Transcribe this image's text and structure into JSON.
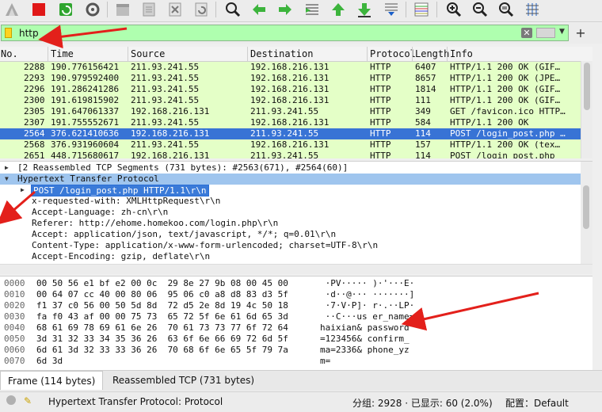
{
  "toolbar": {
    "icons": [
      "shark-fin-icon",
      "stop-capture-icon",
      "restart-capture-icon",
      "capture-options-icon",
      "open-file-icon",
      "save-file-icon",
      "close-file-icon",
      "reload-file-icon",
      "find-packet-icon",
      "go-back-icon",
      "go-forward-icon",
      "go-to-packet-icon",
      "go-first-icon",
      "go-last-icon",
      "auto-scroll-icon",
      "colorize-icon",
      "zoom-in-icon",
      "zoom-out-icon",
      "zoom-normal-icon",
      "resize-columns-icon"
    ]
  },
  "filter": {
    "value": "http",
    "clear_icon": "clear-icon",
    "apply_icon": "apply-arrow-icon",
    "dropdown_icon": "chevron-down-icon",
    "add_label": "+"
  },
  "packet_list": {
    "columns": [
      "No.",
      "Time",
      "Source",
      "Destination",
      "Protocol",
      "Length",
      "Info"
    ],
    "rows": [
      {
        "no": "2288",
        "time": "190.776156421",
        "src": "211.93.241.55",
        "dst": "192.168.216.131",
        "proto": "HTTP",
        "len": "6407",
        "info": "HTTP/1.1 200 OK  (GIF…"
      },
      {
        "no": "2293",
        "time": "190.979592400",
        "src": "211.93.241.55",
        "dst": "192.168.216.131",
        "proto": "HTTP",
        "len": "8657",
        "info": "HTTP/1.1 200 OK  (JPE…"
      },
      {
        "no": "2296",
        "time": "191.286241286",
        "src": "211.93.241.55",
        "dst": "192.168.216.131",
        "proto": "HTTP",
        "len": "1814",
        "info": "HTTP/1.1 200 OK  (GIF…"
      },
      {
        "no": "2300",
        "time": "191.619815902",
        "src": "211.93.241.55",
        "dst": "192.168.216.131",
        "proto": "HTTP",
        "len": "111",
        "info": "HTTP/1.1 200 OK  (GIF…"
      },
      {
        "no": "2305",
        "time": "191.647061337",
        "src": "192.168.216.131",
        "dst": "211.93.241.55",
        "proto": "HTTP",
        "len": "349",
        "info": "GET /favicon.ico HTTP…"
      },
      {
        "no": "2307",
        "time": "191.755552671",
        "src": "211.93.241.55",
        "dst": "192.168.216.131",
        "proto": "HTTP",
        "len": "584",
        "info": "HTTP/1.1 200 OK"
      },
      {
        "no": "2564",
        "time": "376.621410636",
        "src": "192.168.216.131",
        "dst": "211.93.241.55",
        "proto": "HTTP",
        "len": "114",
        "info": "POST /login_post.php …"
      },
      {
        "no": "2568",
        "time": "376.931960604",
        "src": "211.93.241.55",
        "dst": "192.168.216.131",
        "proto": "HTTP",
        "len": "157",
        "info": "HTTP/1.1 200 OK  (tex…"
      },
      {
        "no": "2651",
        "time": "448.715680617",
        "src": "192.168.216.131",
        "dst": "211.93.241.55",
        "proto": "HTTP",
        "len": "114",
        "info": "POST /login_post.php"
      }
    ]
  },
  "details": [
    {
      "text": "[2 Reassembled TCP Segments (731 bytes): #2563(671), #2564(60)]",
      "twisty": "▶",
      "indent": 0
    },
    {
      "text": "Hypertext Transfer Protocol",
      "twisty": "▼",
      "indent": 0
    },
    {
      "text": "POST /login_post.php HTTP/1.1\\r\\n",
      "twisty": "▶",
      "indent": 1
    },
    {
      "text": "x-requested-with: XMLHttpRequest\\r\\n",
      "twisty": "",
      "indent": 1
    },
    {
      "text": "Accept-Language: zh-cn\\r\\n",
      "twisty": "",
      "indent": 1
    },
    {
      "text": "Referer: http://ehome.homekoo.com/login.php\\r\\n",
      "twisty": "",
      "indent": 1
    },
    {
      "text": "Accept: application/json, text/javascript, */*; q=0.01\\r\\n",
      "twisty": "",
      "indent": 1
    },
    {
      "text": "Content-Type: application/x-www-form-urlencoded; charset=UTF-8\\r\\n",
      "twisty": "",
      "indent": 1
    },
    {
      "text": "Accept-Encoding: gzip, deflate\\r\\n",
      "twisty": "",
      "indent": 1
    }
  ],
  "bytes": [
    {
      "off": "0000",
      "hex": "00 50 56 e1 bf e2 00 0c  29 8e 27 9b 08 00 45 00",
      "asc": " ·PV····· )·'···E·"
    },
    {
      "off": "0010",
      "hex": "00 64 07 cc 40 00 80 06  95 06 c0 a8 d8 83 d3 5f",
      "asc": " ·d··@··· ·······]"
    },
    {
      "off": "0020",
      "hex": "f1 37 c0 56 00 50 5d 8d  72 d5 2e 8d 19 4c 50 18",
      "asc": " ·7·V·P]· r·.··LP·"
    },
    {
      "off": "0030",
      "hex": "fa f0 43 af 00 00 75 73  65 72 5f 6e 61 6d 65 3d",
      "asc": " ··C···us er_name="
    },
    {
      "off": "0040",
      "hex": "68 61 69 78 69 61 6e 26  70 61 73 73 77 6f 72 64",
      "asc": "haixian& password"
    },
    {
      "off": "0050",
      "hex": "3d 31 32 33 34 35 36 26  63 6f 6e 66 69 72 6d 5f",
      "asc": "=123456& confirm_"
    },
    {
      "off": "0060",
      "hex": "6d 61 3d 32 33 33 36 26  70 68 6f 6e 65 5f 79 7a",
      "asc": "ma=2336& phone_yz"
    },
    {
      "off": "0070",
      "hex": "6d 3d",
      "asc": "m="
    }
  ],
  "tabs": [
    "Frame (114 bytes)",
    "Reassembled TCP (731 bytes)"
  ],
  "status": {
    "left": "Hypertext Transfer Protocol: Protocol",
    "packets": "分组: 2928 · 已显示: 60 (2.0%)",
    "profile": "配置：Default"
  }
}
